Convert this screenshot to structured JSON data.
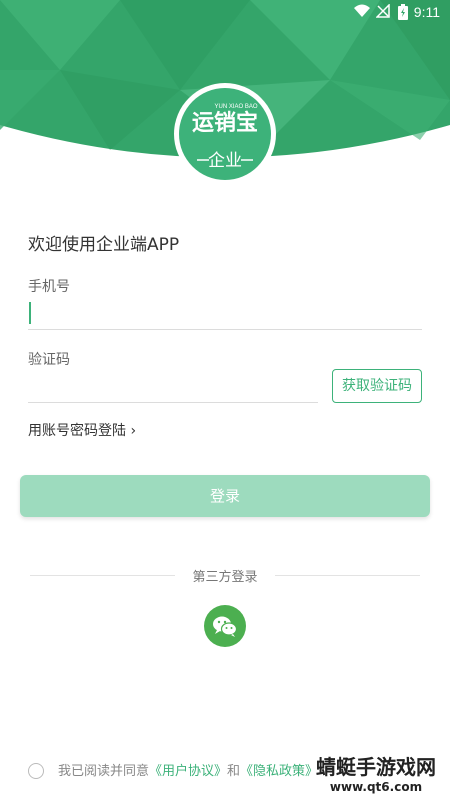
{
  "status_bar": {
    "time": "9:11",
    "icons": [
      "wifi-icon",
      "no-signal-icon",
      "battery-charging-icon"
    ]
  },
  "logo": {
    "brand_text": "运销宝",
    "brand_pinyin": "YUN XIAO BAO",
    "badge": "企业"
  },
  "form": {
    "welcome": "欢迎使用企业端APP",
    "phone_label": "手机号",
    "code_label": "验证码",
    "get_code_button": "获取验证码",
    "password_login_link": "用账号密码登陆",
    "login_button": "登录"
  },
  "third_party": {
    "label": "第三方登录",
    "icon": "wechat-icon"
  },
  "agreement": {
    "prefix": "我已阅读并同意",
    "user_agreement": "《用户协议》",
    "and": "和",
    "privacy_policy": "《隐私政策》"
  },
  "watermark": {
    "line1": "蜻蜓手游戏网",
    "line2": "www.qt6.com"
  },
  "colors": {
    "brand_green": "#3db27a",
    "login_disabled": "#9ddbbe",
    "wechat_green": "#4caf50"
  }
}
